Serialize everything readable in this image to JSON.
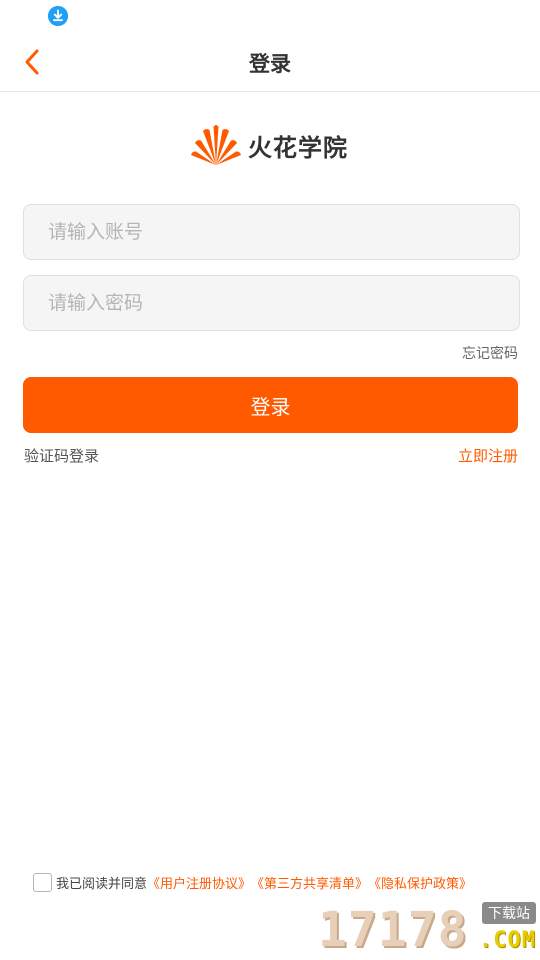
{
  "status_bar": {
    "icons": [
      "download-icon"
    ]
  },
  "header": {
    "title": "登录",
    "back_icon": "chevron-left-icon"
  },
  "brand": {
    "name": "火花学院",
    "icon": "flame-fan-icon"
  },
  "form": {
    "account_placeholder": "请输入账号",
    "password_placeholder": "请输入密码",
    "forgot_password": "忘记密码",
    "login_button": "登录",
    "sms_login": "验证码登录",
    "register": "立即注册"
  },
  "agreement": {
    "checked": false,
    "prefix": "我已阅读并同意",
    "links": [
      "《用户注册协议》",
      "《第三方共享清单》",
      "《隐私保护政策》"
    ]
  },
  "watermark": {
    "number": "17178",
    "tag": "下载站",
    "domain": ".COM"
  },
  "colors": {
    "accent": "#ff5a00",
    "status_icon": "#1ea1f2",
    "field_bg": "#f5f5f5"
  }
}
